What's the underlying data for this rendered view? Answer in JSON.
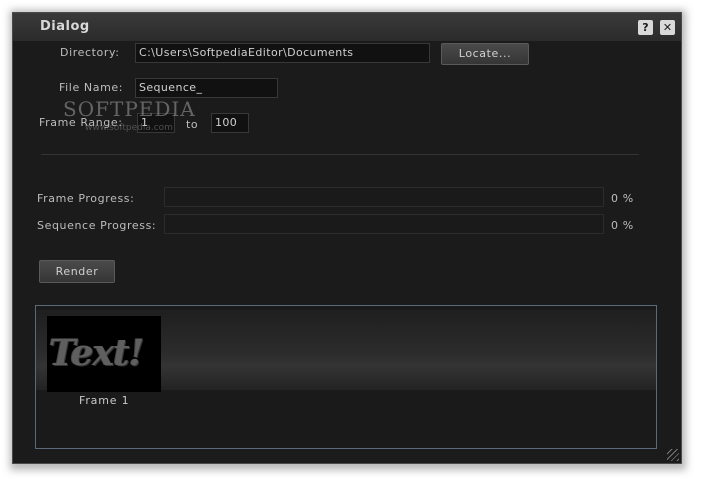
{
  "window": {
    "title": "Dialog",
    "help_label": "?",
    "close_label": "✕"
  },
  "form": {
    "directory_label": "Directory:",
    "directory_value": "C:\\Users\\SoftpediaEditor\\Documents",
    "locate_label": "Locate...",
    "filename_label": "File Name:",
    "filename_value": "Sequence_",
    "frame_range_label": "Frame Range:",
    "range_start": "1",
    "range_to_label": "to",
    "range_end": "100"
  },
  "progress": {
    "frame_label": "Frame Progress:",
    "frame_value": 0,
    "frame_text": "0 %",
    "sequence_label": "Sequence Progress:",
    "sequence_value": 0,
    "sequence_text": "0 %"
  },
  "actions": {
    "render_label": "Render"
  },
  "preview": {
    "thumbnail_text": "Text!",
    "frame_label": "Frame 1"
  },
  "watermark": {
    "brand": "SOFTPEDIA",
    "url": "www.softpedia.com"
  },
  "colors": {
    "background": "#1b1b1b",
    "accent_border": "#5b6a7a",
    "progress_fill": "#4a7db8"
  }
}
